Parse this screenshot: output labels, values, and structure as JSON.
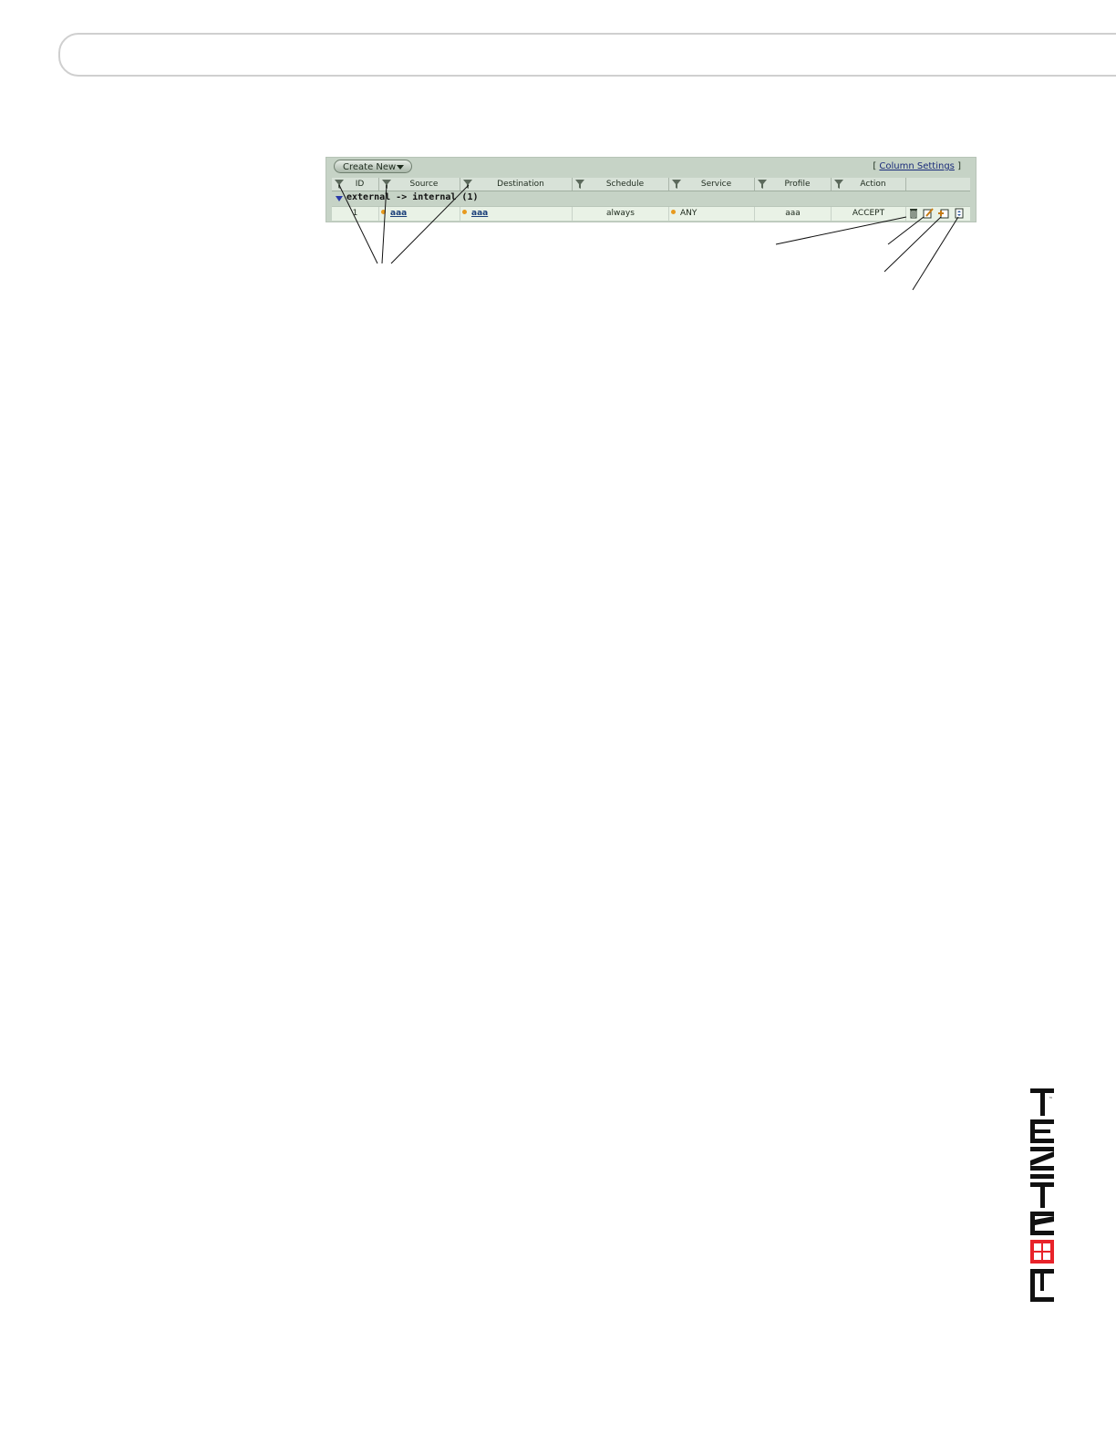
{
  "toolbar": {
    "create_new_label": "Create New",
    "column_settings_open": "[",
    "column_settings_label": "Column Settings",
    "column_settings_close": "]"
  },
  "table": {
    "columns": [
      "ID",
      "Source",
      "Destination",
      "Schedule",
      "Service",
      "Profile",
      "Action"
    ],
    "group": {
      "label": "external -> internal (1)"
    },
    "rows": [
      {
        "id": "1",
        "source": "aaa",
        "destination": "aaa",
        "schedule": "always",
        "service": "ANY",
        "profile": "aaa",
        "action": "ACCEPT"
      }
    ]
  },
  "icons": [
    "funnel-icon",
    "delete-icon",
    "edit-icon",
    "insert-policy-icon",
    "move-icon",
    "collapse-triangle-icon"
  ],
  "colors": {
    "frame": "#c6d3c6",
    "row": "#e9f2e6",
    "link": "#1a3f7a",
    "bullet": "#e79a1e",
    "logo_accent": "#e8232a"
  },
  "logo": {
    "text": "FORTINET"
  }
}
